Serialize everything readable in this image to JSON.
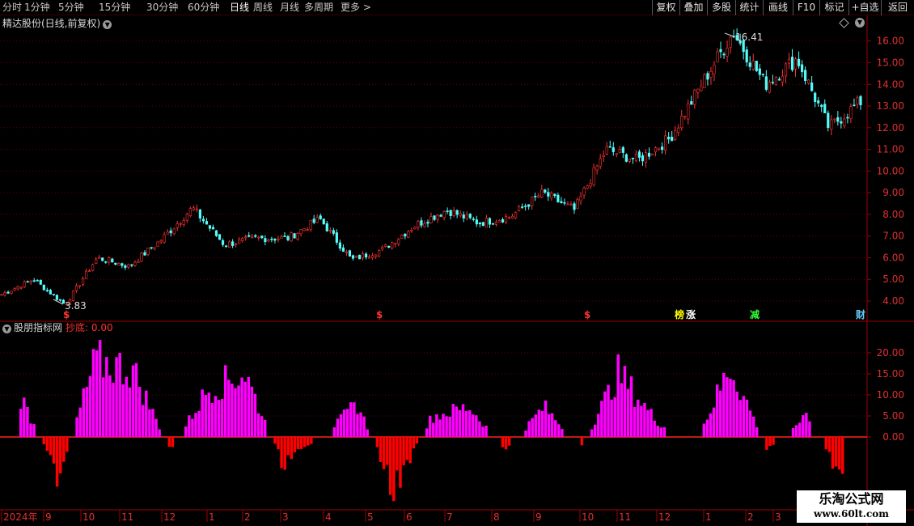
{
  "toolbar": {
    "periods": [
      {
        "label": "分时",
        "active": false
      },
      {
        "label": "1分钟",
        "active": false
      },
      {
        "label": "5分钟",
        "active": false
      },
      {
        "label": "15分钟",
        "active": false
      },
      {
        "label": "30分钟",
        "active": false
      },
      {
        "label": "60分钟",
        "active": false
      },
      {
        "label": "日线",
        "active": true
      },
      {
        "label": "周线",
        "active": false
      },
      {
        "label": "月线",
        "active": false
      },
      {
        "label": "多周期",
        "active": false
      },
      {
        "label": "更多",
        "active": false
      }
    ],
    "right_buttons": [
      "复权",
      "叠加",
      "多股",
      "统计",
      "画线",
      "F10",
      "标记",
      "+自选",
      "返回"
    ]
  },
  "main_chart": {
    "title": "精达股份(日线,前复权)",
    "y_axis_ticks": [
      16.0,
      15.0,
      14.0,
      13.0,
      12.0,
      11.0,
      10.0,
      9.0,
      8.0,
      7.0,
      6.0,
      5.0,
      4.0
    ],
    "y_axis_ticks_text": [
      "16.00",
      "15.00",
      "14.00",
      "13.00",
      "12.00",
      "11.00",
      "10.00",
      "9.00",
      "8.00",
      "7.00",
      "6.00",
      "5.00",
      "4.00"
    ],
    "high_label": "16.41",
    "low_label": "3.83",
    "markers": [
      {
        "symbol": "$",
        "color": "#ff3333"
      },
      {
        "symbol": "$",
        "color": "#ff3333"
      },
      {
        "symbol": "$",
        "color": "#ff3333"
      },
      {
        "symbol": "榜",
        "color": "#ffff00"
      },
      {
        "symbol": "涨",
        "color": "#ffffff"
      },
      {
        "symbol": "减",
        "color": "#33ff33"
      },
      {
        "symbol": "财",
        "color": "#66ccff"
      }
    ]
  },
  "indicator": {
    "name": "股朋指标网",
    "label": "抄底: 0.00",
    "y_axis_ticks": [
      20.0,
      15.0,
      10.0,
      5.0,
      0.0
    ],
    "y_axis_ticks_text": [
      "20.00",
      "15.00",
      "10.00",
      "5.00",
      "0.00"
    ]
  },
  "time_axis": {
    "labels": [
      "2024年",
      "9",
      "10",
      "11",
      "12",
      "1",
      "2",
      "3",
      "4",
      "5",
      "6",
      "7",
      "8",
      "9",
      "10",
      "11",
      "12",
      "1",
      "2",
      "3"
    ]
  },
  "watermark": {
    "line1": "乐淘公式网",
    "line2": "www.60lt.com"
  },
  "chart_data": {
    "type": "candlestick",
    "title": "精达股份(日线,前复权)",
    "xlabel": "",
    "ylabel": "",
    "ylim": [
      3.5,
      16.9
    ],
    "grid": true,
    "price_anchors": [
      {
        "month": "2024-08",
        "value": 4.3
      },
      {
        "month": "2024-08",
        "value": 5.0
      },
      {
        "month": "2024-09",
        "value": 3.83
      },
      {
        "month": "2024-10",
        "value": 6.0
      },
      {
        "month": "2024-10",
        "value": 5.6
      },
      {
        "month": "2024-11",
        "value": 6.8
      },
      {
        "month": "2024-12",
        "value": 8.3
      },
      {
        "month": "2024-12",
        "value": 6.6
      },
      {
        "month": "2025-01",
        "value": 6.9
      },
      {
        "month": "2025-02",
        "value": 6.9
      },
      {
        "month": "2025-03",
        "value": 7.8
      },
      {
        "month": "2025-04",
        "value": 5.9
      },
      {
        "month": "2025-04",
        "value": 6.4
      },
      {
        "month": "2025-05",
        "value": 7.5
      },
      {
        "month": "2025-06",
        "value": 8.2
      },
      {
        "month": "2025-07",
        "value": 7.6
      },
      {
        "month": "2025-08",
        "value": 7.9
      },
      {
        "month": "2025-09",
        "value": 9.0
      },
      {
        "month": "2025-09",
        "value": 8.2
      },
      {
        "month": "2025-10",
        "value": 11.0
      },
      {
        "month": "2025-11",
        "value": 10.5
      },
      {
        "month": "2025-12",
        "value": 11.5
      },
      {
        "month": "2026-01",
        "value": 14.0
      },
      {
        "month": "2026-01",
        "value": 16.41
      },
      {
        "month": "2026-02",
        "value": 14.0
      },
      {
        "month": "2026-02",
        "value": 15.2
      },
      {
        "month": "2026-03",
        "value": 12.0
      },
      {
        "month": "2026-03",
        "value": 13.2
      }
    ],
    "indicator_series": {
      "name": "抄底",
      "ylim": [
        -16,
        22
      ],
      "positive_color": "#ff00ff",
      "negative_color": "#ff0000",
      "segments": [
        {
          "month": "2024-08",
          "value": 12
        },
        {
          "month": "2024-09",
          "value": -12
        },
        {
          "month": "2024-10",
          "value": 22.5
        },
        {
          "month": "2024-10",
          "value": 20
        },
        {
          "month": "2024-11",
          "value": -4
        },
        {
          "month": "2024-12",
          "value": 14
        },
        {
          "month": "2024-12",
          "value": 19
        },
        {
          "month": "2025-01",
          "value": -8
        },
        {
          "month": "2025-02",
          "value": -1
        },
        {
          "month": "2025-03",
          "value": 10
        },
        {
          "month": "2025-04",
          "value": -16
        },
        {
          "month": "2025-05",
          "value": 6
        },
        {
          "month": "2025-06",
          "value": 9
        },
        {
          "month": "2025-07",
          "value": -4
        },
        {
          "month": "2025-08",
          "value": 9
        },
        {
          "month": "2025-09",
          "value": -3
        },
        {
          "month": "2025-10",
          "value": 19
        },
        {
          "month": "2025-11",
          "value": 5
        },
        {
          "month": "2025-12",
          "value": -3
        },
        {
          "month": "2026-01",
          "value": 21
        },
        {
          "month": "2026-02",
          "value": -4
        },
        {
          "month": "2026-02",
          "value": 6
        },
        {
          "month": "2026-03",
          "value": -12
        }
      ]
    }
  }
}
